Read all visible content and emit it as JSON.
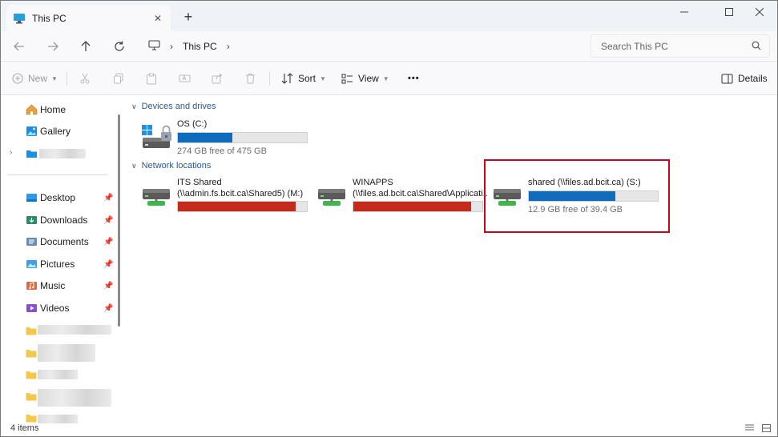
{
  "window": {
    "tab_title": "This PC",
    "new_tab_symbol": "+",
    "close_tab_symbol": "✕",
    "minimize_symbol": "—",
    "maximize_symbol": "☐",
    "close_symbol": "✕"
  },
  "navigation": {
    "breadcrumb": [
      "This PC"
    ],
    "search_placeholder": "Search This PC"
  },
  "commandbar": {
    "new_label": "New",
    "sort_label": "Sort",
    "view_label": "View",
    "more_label": "•••",
    "details_label": "Details"
  },
  "sidebar": {
    "home": "Home",
    "gallery": "Gallery",
    "quick_access": [
      {
        "label": "Desktop",
        "icon": "desktop-icon"
      },
      {
        "label": "Downloads",
        "icon": "downloads-icon"
      },
      {
        "label": "Documents",
        "icon": "documents-icon"
      },
      {
        "label": "Pictures",
        "icon": "pictures-icon"
      },
      {
        "label": "Music",
        "icon": "music-icon"
      },
      {
        "label": "Videos",
        "icon": "videos-icon"
      }
    ]
  },
  "content": {
    "sections": {
      "devices": "Devices and drives",
      "network": "Network locations"
    },
    "devices": [
      {
        "name": "OS (C:)",
        "free_text": "274 GB free of 475 GB",
        "used_fraction": 0.42,
        "bar_color": "#0f6cbd"
      }
    ],
    "network": [
      {
        "name": "ITS Shared",
        "path": "(\\\\admin.fs.bcit.ca\\Shared5) (M:)",
        "used_fraction": 0.91,
        "bar_color": "#c42b1c",
        "free_text": ""
      },
      {
        "name": "WINAPPS",
        "path": "(\\\\files.ad.bcit.ca\\Shared\\Applicati...",
        "used_fraction": 0.91,
        "bar_color": "#c42b1c",
        "free_text": ""
      },
      {
        "name": "shared (\\\\files.ad.bcit.ca) (S:)",
        "path": "",
        "used_fraction": 0.67,
        "bar_color": "#0f6cbd",
        "free_text": "12.9 GB free of 39.4 GB"
      }
    ]
  },
  "statusbar": {
    "item_count": "4 items"
  },
  "colors": {
    "accent": "#0f6cbd",
    "warning_bar": "#c42b1c",
    "highlight_box": "#d0021b"
  }
}
